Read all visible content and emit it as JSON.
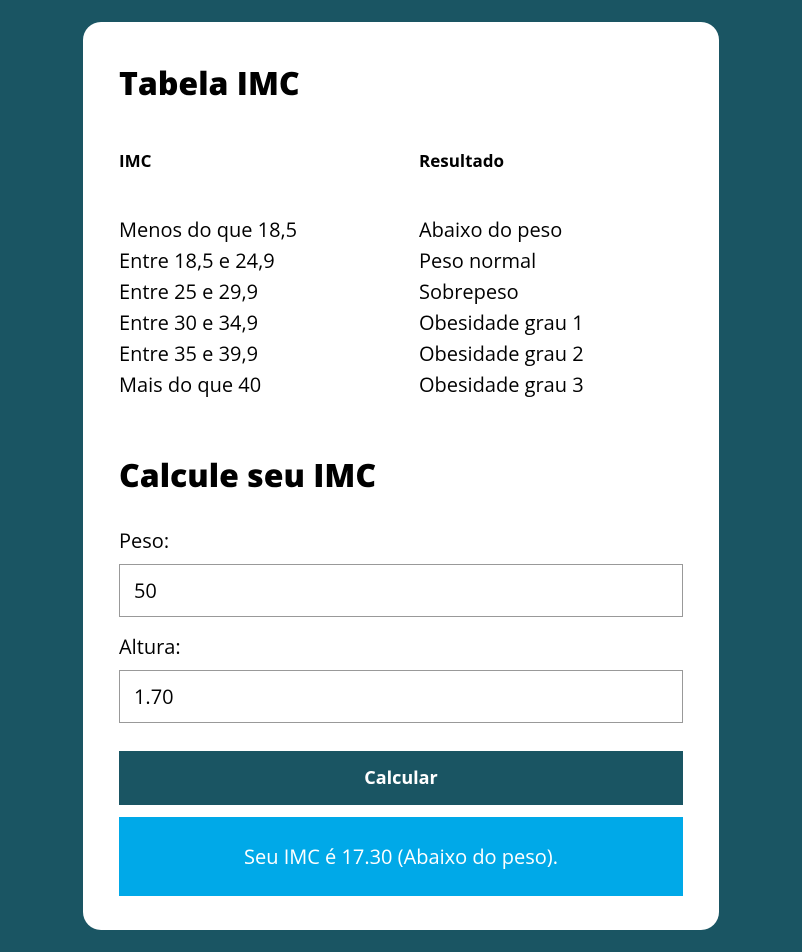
{
  "titles": {
    "table": "Tabela IMC",
    "form": "Calcule seu IMC"
  },
  "headers": {
    "imc": "IMC",
    "result": "Resultado"
  },
  "rows": [
    {
      "range": "Menos do que 18,5",
      "label": "Abaixo do peso"
    },
    {
      "range": "Entre 18,5 e 24,9",
      "label": "Peso normal"
    },
    {
      "range": "Entre 25 e 29,9",
      "label": "Sobrepeso"
    },
    {
      "range": "Entre 30 e 34,9",
      "label": "Obesidade grau 1"
    },
    {
      "range": "Entre 35 e 39,9",
      "label": "Obesidade grau 2"
    },
    {
      "range": "Mais do que 40",
      "label": "Obesidade grau 3"
    }
  ],
  "form": {
    "weight_label": "Peso:",
    "weight_value": "50",
    "height_label": "Altura:",
    "height_value": "1.70",
    "button": "Calcular"
  },
  "result": "Seu IMC é 17.30 (Abaixo do peso)."
}
